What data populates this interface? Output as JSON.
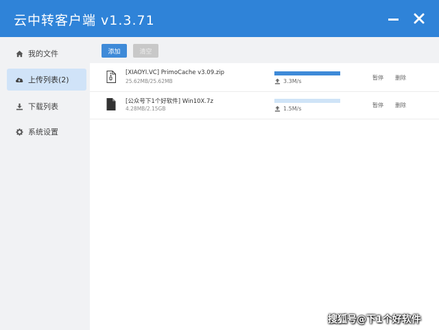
{
  "app": {
    "title": "云中转客户端 v1.3.71"
  },
  "window_controls": {
    "minimize_icon": "minimize-icon",
    "close_icon": "close-icon"
  },
  "sidebar": {
    "items": [
      {
        "label": "我的文件",
        "icon": "home-icon"
      },
      {
        "label": "上传列表(2)",
        "icon": "cloud-upload-icon",
        "active": true
      },
      {
        "label": "下载列表",
        "icon": "download-icon"
      },
      {
        "label": "系统设置",
        "icon": "gear-icon"
      }
    ]
  },
  "toolbar": {
    "add_label": "添加",
    "clear_label": "清空"
  },
  "uploads": [
    {
      "name": "[XIAOYI.VC] PrimoCache v3.09.zip",
      "size": "25.62MB/25.62MB",
      "progress": 1.0,
      "speed": "3.3M/s",
      "pause_label": "暂停",
      "delete_label": "删除",
      "icon": "zip-file-icon"
    },
    {
      "name": "[公众号下1个好软件] Win10X.7z",
      "size": "4.28MB/2.15GB",
      "progress": 0.0,
      "speed": "1.5M/s",
      "pause_label": "暂停",
      "delete_label": "删除",
      "icon": "file-icon"
    }
  ],
  "colors": {
    "titlebar": "#2f83d8",
    "accent": "#3e8ad8",
    "active_item": "#d0e3f8"
  },
  "watermark": "搜狐号@下1个好软件"
}
